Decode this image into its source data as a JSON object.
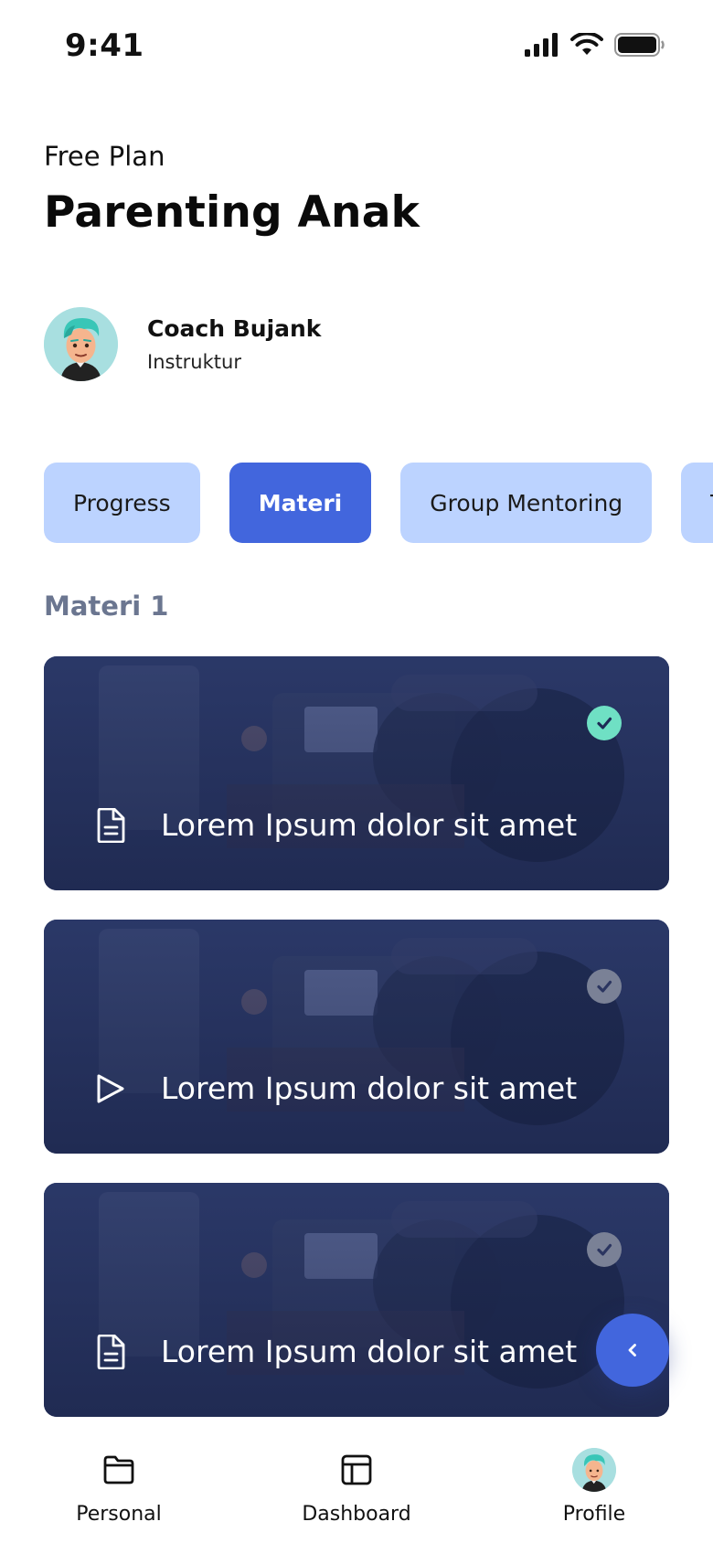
{
  "status_bar": {
    "time": "9:41"
  },
  "header": {
    "plan": "Free Plan",
    "title": "Parenting Anak"
  },
  "instructor": {
    "name": "Coach Bujank",
    "role": "Instruktur"
  },
  "tabs": [
    {
      "label": "Progress",
      "active": false
    },
    {
      "label": "Materi",
      "active": true
    },
    {
      "label": "Group Mentoring",
      "active": false
    },
    {
      "label": "Te",
      "active": false
    }
  ],
  "section": {
    "title": "Materi 1"
  },
  "cards": [
    {
      "title": "Lorem Ipsum dolor sit amet",
      "type_icon": "document-icon",
      "completed": true
    },
    {
      "title": "Lorem Ipsum dolor sit amet",
      "type_icon": "play-icon",
      "completed": false
    },
    {
      "title": "Lorem Ipsum dolor sit amet",
      "type_icon": "document-icon",
      "completed": false
    }
  ],
  "bottom_nav": [
    {
      "label": "Personal",
      "icon": "folder-icon"
    },
    {
      "label": "Dashboard",
      "icon": "layout-icon"
    },
    {
      "label": "Profile",
      "icon": "avatar"
    }
  ],
  "colors": {
    "accent": "#4266dd",
    "tab_inactive": "#bcd3ff",
    "check_done": "#6fe0c4",
    "check_todo": "#7a8196",
    "section_title": "#6b7690"
  }
}
